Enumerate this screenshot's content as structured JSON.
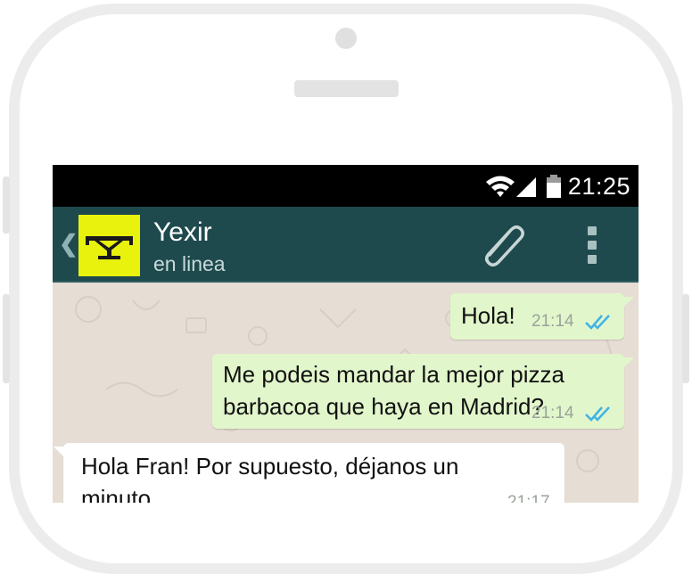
{
  "status_bar": {
    "time": "21:25",
    "icons": [
      "wifi-icon",
      "signal-icon",
      "battery-icon"
    ]
  },
  "chat_header": {
    "back_icon": "chevron-left-icon",
    "contact_name": "Yexir",
    "contact_status": "en linea",
    "attach_icon": "paperclip-icon",
    "menu_icon": "overflow-menu-icon"
  },
  "messages": [
    {
      "direction": "outgoing",
      "text": "Hola!",
      "time": "21:14",
      "status": "read"
    },
    {
      "direction": "outgoing",
      "text": "Me podeis mandar la mejor pizza\nbarbacoa que haya en Madrid?",
      "time": "21:14",
      "status": "read"
    },
    {
      "direction": "incoming",
      "text": "Hola Fran! Por supuesto, déjanos un\nminuto",
      "time": "21:17"
    }
  ],
  "colors": {
    "header_bg": "#1e4a4d",
    "avatar_bg": "#e8f20c",
    "outgoing_bubble": "#e2f6cb",
    "read_ticks": "#3fb3e6"
  }
}
